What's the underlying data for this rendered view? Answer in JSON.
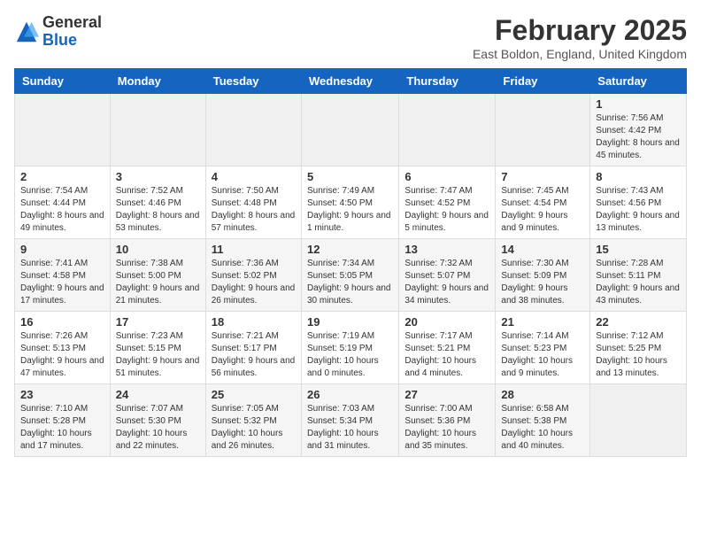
{
  "header": {
    "logo_line1": "General",
    "logo_line2": "Blue",
    "month_title": "February 2025",
    "location": "East Boldon, England, United Kingdom"
  },
  "weekdays": [
    "Sunday",
    "Monday",
    "Tuesday",
    "Wednesday",
    "Thursday",
    "Friday",
    "Saturday"
  ],
  "weeks": [
    [
      {
        "day": "",
        "info": ""
      },
      {
        "day": "",
        "info": ""
      },
      {
        "day": "",
        "info": ""
      },
      {
        "day": "",
        "info": ""
      },
      {
        "day": "",
        "info": ""
      },
      {
        "day": "",
        "info": ""
      },
      {
        "day": "1",
        "info": "Sunrise: 7:56 AM\nSunset: 4:42 PM\nDaylight: 8 hours and 45 minutes."
      }
    ],
    [
      {
        "day": "2",
        "info": "Sunrise: 7:54 AM\nSunset: 4:44 PM\nDaylight: 8 hours and 49 minutes."
      },
      {
        "day": "3",
        "info": "Sunrise: 7:52 AM\nSunset: 4:46 PM\nDaylight: 8 hours and 53 minutes."
      },
      {
        "day": "4",
        "info": "Sunrise: 7:50 AM\nSunset: 4:48 PM\nDaylight: 8 hours and 57 minutes."
      },
      {
        "day": "5",
        "info": "Sunrise: 7:49 AM\nSunset: 4:50 PM\nDaylight: 9 hours and 1 minute."
      },
      {
        "day": "6",
        "info": "Sunrise: 7:47 AM\nSunset: 4:52 PM\nDaylight: 9 hours and 5 minutes."
      },
      {
        "day": "7",
        "info": "Sunrise: 7:45 AM\nSunset: 4:54 PM\nDaylight: 9 hours and 9 minutes."
      },
      {
        "day": "8",
        "info": "Sunrise: 7:43 AM\nSunset: 4:56 PM\nDaylight: 9 hours and 13 minutes."
      }
    ],
    [
      {
        "day": "9",
        "info": "Sunrise: 7:41 AM\nSunset: 4:58 PM\nDaylight: 9 hours and 17 minutes."
      },
      {
        "day": "10",
        "info": "Sunrise: 7:38 AM\nSunset: 5:00 PM\nDaylight: 9 hours and 21 minutes."
      },
      {
        "day": "11",
        "info": "Sunrise: 7:36 AM\nSunset: 5:02 PM\nDaylight: 9 hours and 26 minutes."
      },
      {
        "day": "12",
        "info": "Sunrise: 7:34 AM\nSunset: 5:05 PM\nDaylight: 9 hours and 30 minutes."
      },
      {
        "day": "13",
        "info": "Sunrise: 7:32 AM\nSunset: 5:07 PM\nDaylight: 9 hours and 34 minutes."
      },
      {
        "day": "14",
        "info": "Sunrise: 7:30 AM\nSunset: 5:09 PM\nDaylight: 9 hours and 38 minutes."
      },
      {
        "day": "15",
        "info": "Sunrise: 7:28 AM\nSunset: 5:11 PM\nDaylight: 9 hours and 43 minutes."
      }
    ],
    [
      {
        "day": "16",
        "info": "Sunrise: 7:26 AM\nSunset: 5:13 PM\nDaylight: 9 hours and 47 minutes."
      },
      {
        "day": "17",
        "info": "Sunrise: 7:23 AM\nSunset: 5:15 PM\nDaylight: 9 hours and 51 minutes."
      },
      {
        "day": "18",
        "info": "Sunrise: 7:21 AM\nSunset: 5:17 PM\nDaylight: 9 hours and 56 minutes."
      },
      {
        "day": "19",
        "info": "Sunrise: 7:19 AM\nSunset: 5:19 PM\nDaylight: 10 hours and 0 minutes."
      },
      {
        "day": "20",
        "info": "Sunrise: 7:17 AM\nSunset: 5:21 PM\nDaylight: 10 hours and 4 minutes."
      },
      {
        "day": "21",
        "info": "Sunrise: 7:14 AM\nSunset: 5:23 PM\nDaylight: 10 hours and 9 minutes."
      },
      {
        "day": "22",
        "info": "Sunrise: 7:12 AM\nSunset: 5:25 PM\nDaylight: 10 hours and 13 minutes."
      }
    ],
    [
      {
        "day": "23",
        "info": "Sunrise: 7:10 AM\nSunset: 5:28 PM\nDaylight: 10 hours and 17 minutes."
      },
      {
        "day": "24",
        "info": "Sunrise: 7:07 AM\nSunset: 5:30 PM\nDaylight: 10 hours and 22 minutes."
      },
      {
        "day": "25",
        "info": "Sunrise: 7:05 AM\nSunset: 5:32 PM\nDaylight: 10 hours and 26 minutes."
      },
      {
        "day": "26",
        "info": "Sunrise: 7:03 AM\nSunset: 5:34 PM\nDaylight: 10 hours and 31 minutes."
      },
      {
        "day": "27",
        "info": "Sunrise: 7:00 AM\nSunset: 5:36 PM\nDaylight: 10 hours and 35 minutes."
      },
      {
        "day": "28",
        "info": "Sunrise: 6:58 AM\nSunset: 5:38 PM\nDaylight: 10 hours and 40 minutes."
      },
      {
        "day": "",
        "info": ""
      }
    ]
  ]
}
